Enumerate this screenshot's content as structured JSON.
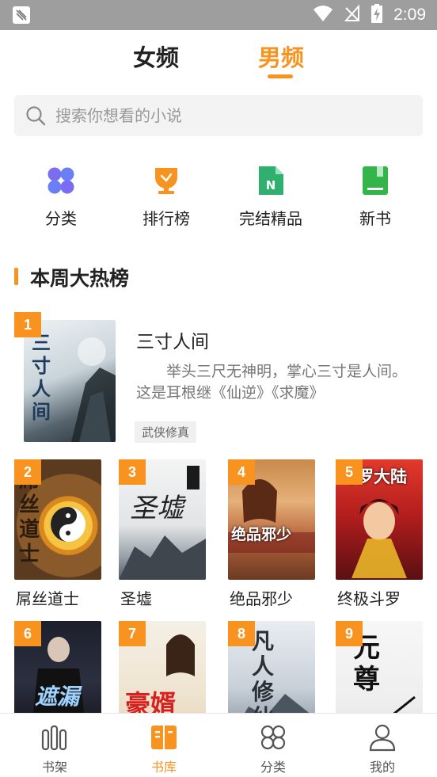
{
  "status_bar": {
    "time": "2:09"
  },
  "top_tabs": {
    "female": "女频",
    "male": "男频"
  },
  "search": {
    "placeholder": "搜索你想看的小说"
  },
  "categories": [
    {
      "label": "分类",
      "icon": "clover-icon",
      "color": "#6b6ef5"
    },
    {
      "label": "排行榜",
      "icon": "trophy-icon",
      "color": "#f7931e"
    },
    {
      "label": "完结精品",
      "icon": "document-n-icon",
      "color": "#2fb06f"
    },
    {
      "label": "新书",
      "icon": "new-book-icon",
      "color": "#33b54a"
    }
  ],
  "section": {
    "title": "本周大热榜"
  },
  "featured": {
    "rank": "1",
    "title": "三寸人间",
    "description": "举头三尺无神明，掌心三寸是人间。这是耳根继《仙逆》《求魔》",
    "tag": "武侠修真",
    "cover_text": "三寸人间"
  },
  "books": [
    {
      "rank": "2",
      "title": "屌丝道士",
      "cover_text": "屌丝道士"
    },
    {
      "rank": "3",
      "title": "圣墟",
      "cover_text": "圣墟"
    },
    {
      "rank": "4",
      "title": "绝品邪少",
      "cover_text": "绝品邪少"
    },
    {
      "rank": "5",
      "title": "终极斗罗",
      "cover_text": "斗罗大陆"
    },
    {
      "rank": "6",
      "title": "",
      "cover_text": "遮漏"
    },
    {
      "rank": "7",
      "title": "",
      "cover_text": "豪婿"
    },
    {
      "rank": "8",
      "title": "",
      "cover_text": "凡人修仙"
    },
    {
      "rank": "9",
      "title": "",
      "cover_text": "元尊"
    }
  ],
  "bottom_nav": [
    {
      "label": "书架",
      "icon": "bookshelf-icon"
    },
    {
      "label": "书库",
      "icon": "open-book-icon",
      "active": true
    },
    {
      "label": "分类",
      "icon": "grid-clover-icon"
    },
    {
      "label": "我的",
      "icon": "user-icon"
    }
  ],
  "colors": {
    "accent": "#f7931e",
    "status_bar": "#9e9e9e"
  }
}
